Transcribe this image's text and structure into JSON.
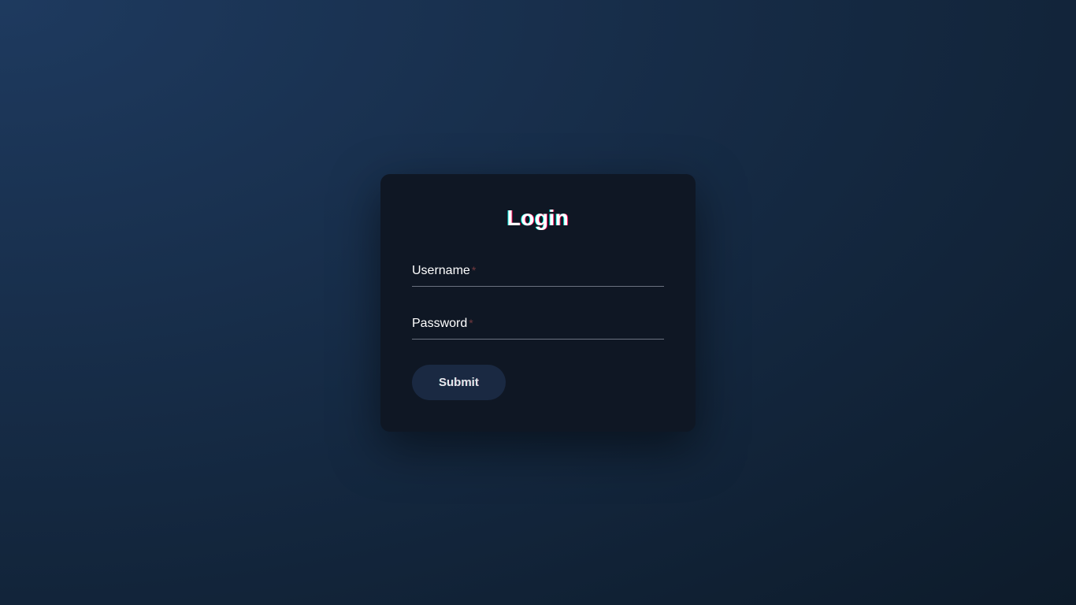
{
  "login": {
    "title": "Login",
    "fields": {
      "username": {
        "label": "Username",
        "value": ""
      },
      "password": {
        "label": "Password",
        "value": ""
      }
    },
    "submit_label": "Submit",
    "required_marker": "*"
  }
}
